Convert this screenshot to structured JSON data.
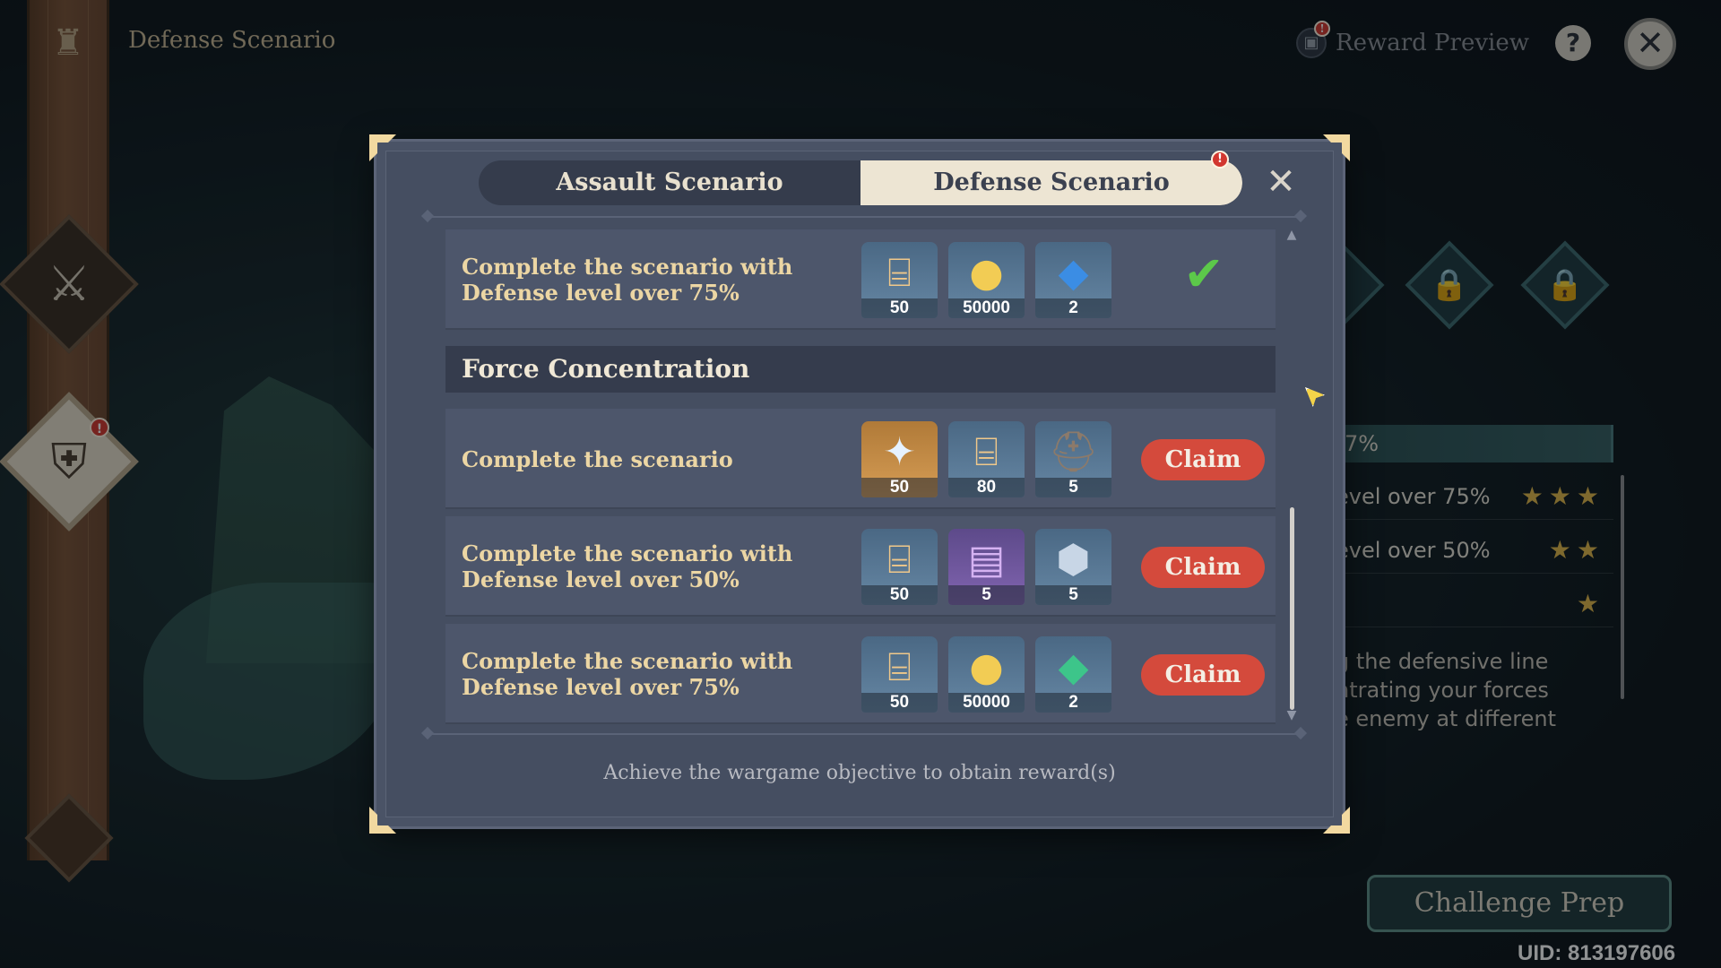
{
  "header": {
    "title": "Defense Scenario",
    "reward_preview_label": "Reward Preview",
    "reward_preview_alert": "!",
    "help_symbol": "?",
    "close_symbol": "✕"
  },
  "sidebar": {
    "top_icon": "trophy-stand-icon",
    "items": [
      {
        "icon": "crossed-swords-icon",
        "glyph": "⚔",
        "alert": ""
      },
      {
        "icon": "shield-castle-icon",
        "glyph": "⛨",
        "alert": "!"
      }
    ]
  },
  "background_panel": {
    "progress_label": "7%",
    "star_rows": [
      {
        "label": "evel over 75%",
        "stars": "★★★"
      },
      {
        "label": "evel over 50%",
        "stars": "★★"
      },
      {
        "label": "",
        "stars": "★"
      }
    ],
    "description_lines": [
      "g the defensive line",
      "ntrating your forces",
      "e enemy at different"
    ],
    "lock_glyph": "🔒",
    "challenge_button": "Challenge Prep",
    "uid": "UID: 813197606"
  },
  "modal": {
    "tabs": [
      {
        "label": "Assault Scenario",
        "active": false
      },
      {
        "label": "Defense Scenario",
        "active": true
      }
    ],
    "tab_alert": "!",
    "close_symbol": "✕",
    "rows_top": [
      {
        "text": "Complete the scenario with Defense level over 75%",
        "rewards": [
          {
            "icon": "wargame-banner-icon",
            "count": "50"
          },
          {
            "icon": "mora-coin-icon",
            "count": "50000"
          },
          {
            "icon": "blue-crystal-icon",
            "count": "2"
          }
        ],
        "status": "claimed",
        "check_symbol": "✔"
      }
    ],
    "section_title": "Force Concentration",
    "rows": [
      {
        "text": "Complete the scenario",
        "rewards": [
          {
            "icon": "primogem-icon",
            "count": "50"
          },
          {
            "icon": "wargame-banner-icon",
            "count": "80"
          },
          {
            "icon": "helmet-material-icon",
            "count": "5"
          }
        ],
        "claim_label": "Claim"
      },
      {
        "text": "Complete the scenario with Defense level over 50%",
        "rewards": [
          {
            "icon": "wargame-banner-icon",
            "count": "50"
          },
          {
            "icon": "talent-book-icon",
            "count": "5"
          },
          {
            "icon": "shield-material-icon",
            "count": "5"
          }
        ],
        "claim_label": "Claim"
      },
      {
        "text": "Complete the scenario with Defense level over 75%",
        "rewards": [
          {
            "icon": "wargame-banner-icon",
            "count": "50"
          },
          {
            "icon": "mora-coin-icon",
            "count": "50000"
          },
          {
            "icon": "green-crystal-icon",
            "count": "2"
          }
        ],
        "claim_label": "Claim"
      }
    ],
    "footer_hint": "Achieve the wargame objective to obtain reward(s)"
  },
  "colors": {
    "claim_button": "#d44a3c",
    "active_tab": "#ede5d3",
    "row_text": "#ecd6a4",
    "check": "#5cc84a"
  }
}
